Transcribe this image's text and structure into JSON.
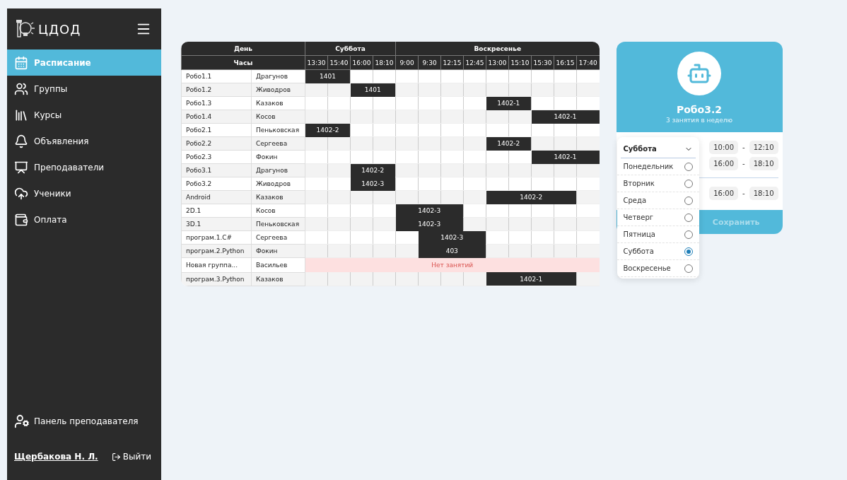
{
  "sidebar": {
    "logo_text": "ЦДОД",
    "items": [
      {
        "label": "Расписание",
        "selected": true
      },
      {
        "label": "Группы",
        "selected": false
      },
      {
        "label": "Курсы",
        "selected": false
      },
      {
        "label": "Объявления",
        "selected": false
      },
      {
        "label": "Преподаватели",
        "selected": false
      },
      {
        "label": "Ученики",
        "selected": false
      },
      {
        "label": "Оплата",
        "selected": false
      }
    ],
    "teacher_panel": "Панель преподавателя",
    "user_name": "Щербакова Н. Л.",
    "logout": "Выйти"
  },
  "schedule": {
    "day_header": "День",
    "hours_header": "Часы",
    "days": [
      {
        "name": "Суббота",
        "times": [
          "13:30",
          "15:40",
          "16:00",
          "18:10"
        ]
      },
      {
        "name": "Воскресенье",
        "times": [
          "9:00",
          "9:30",
          "12:15",
          "12:45",
          "13:00",
          "15:10",
          "15:30",
          "16:15",
          "17:40"
        ]
      }
    ],
    "rows": [
      {
        "group": "Робо1.1",
        "teacher": "Драгунов",
        "slots": [
          {
            "busy": true,
            "room": "1401"
          },
          {
            "busy": true
          },
          {
            "busy": false
          },
          {
            "busy": false
          },
          {
            "busy": false
          },
          {
            "busy": false
          },
          {
            "busy": false
          },
          {
            "busy": false
          },
          {
            "busy": false
          },
          {
            "busy": false
          },
          {
            "busy": false
          },
          {
            "busy": false
          },
          {
            "busy": false
          }
        ]
      },
      {
        "group": "Робо1.2",
        "teacher": "Живодров",
        "slots": [
          {
            "busy": false
          },
          {
            "busy": false
          },
          {
            "busy": true,
            "room": "1401"
          },
          {
            "busy": true
          },
          {
            "busy": false
          },
          {
            "busy": false
          },
          {
            "busy": false
          },
          {
            "busy": false
          },
          {
            "busy": false
          },
          {
            "busy": false
          },
          {
            "busy": false
          },
          {
            "busy": false
          },
          {
            "busy": false
          }
        ]
      },
      {
        "group": "Робо1.3",
        "teacher": "Казаков",
        "slots": [
          {
            "busy": false
          },
          {
            "busy": false
          },
          {
            "busy": false
          },
          {
            "busy": false
          },
          {
            "busy": false
          },
          {
            "busy": false
          },
          {
            "busy": false
          },
          {
            "busy": false
          },
          {
            "busy": true,
            "room": "1402-1"
          },
          {
            "busy": true
          },
          {
            "busy": false
          },
          {
            "busy": false
          },
          {
            "busy": false
          }
        ]
      },
      {
        "group": "Робо1.4",
        "teacher": "Косов",
        "slots": [
          {
            "busy": false
          },
          {
            "busy": false
          },
          {
            "busy": false
          },
          {
            "busy": false
          },
          {
            "busy": false
          },
          {
            "busy": false
          },
          {
            "busy": false
          },
          {
            "busy": false
          },
          {
            "busy": false
          },
          {
            "busy": false
          },
          {
            "busy": true,
            "room": "1402-1"
          },
          {
            "busy": true
          },
          {
            "busy": true
          }
        ]
      },
      {
        "group": "Робо2.1",
        "teacher": "Пеньковская",
        "slots": [
          {
            "busy": true,
            "room": "1402-2"
          },
          {
            "busy": true
          },
          {
            "busy": false
          },
          {
            "busy": false
          },
          {
            "busy": false
          },
          {
            "busy": false
          },
          {
            "busy": false
          },
          {
            "busy": false
          },
          {
            "busy": false
          },
          {
            "busy": false
          },
          {
            "busy": false
          },
          {
            "busy": false
          },
          {
            "busy": false
          }
        ]
      },
      {
        "group": "Робо2.2",
        "teacher": "Сергеева",
        "slots": [
          {
            "busy": false
          },
          {
            "busy": false
          },
          {
            "busy": false
          },
          {
            "busy": false
          },
          {
            "busy": false
          },
          {
            "busy": false
          },
          {
            "busy": false
          },
          {
            "busy": false
          },
          {
            "busy": true,
            "room": "1402-2"
          },
          {
            "busy": true
          },
          {
            "busy": false
          },
          {
            "busy": false
          },
          {
            "busy": false
          }
        ]
      },
      {
        "group": "Робо2.3",
        "teacher": "Фокин",
        "slots": [
          {
            "busy": false
          },
          {
            "busy": false
          },
          {
            "busy": false
          },
          {
            "busy": false
          },
          {
            "busy": false
          },
          {
            "busy": false
          },
          {
            "busy": false
          },
          {
            "busy": false
          },
          {
            "busy": false
          },
          {
            "busy": false
          },
          {
            "busy": true,
            "room": "1402-1"
          },
          {
            "busy": true
          },
          {
            "busy": true
          }
        ]
      },
      {
        "group": "Робо3.1",
        "teacher": "Драгунов",
        "slots": [
          {
            "busy": false
          },
          {
            "busy": false
          },
          {
            "busy": true,
            "room": "1402-2"
          },
          {
            "busy": true
          },
          {
            "busy": false
          },
          {
            "busy": false
          },
          {
            "busy": false
          },
          {
            "busy": false
          },
          {
            "busy": false
          },
          {
            "busy": false
          },
          {
            "busy": false
          },
          {
            "busy": false
          },
          {
            "busy": false
          }
        ]
      },
      {
        "group": "Робо3.2",
        "teacher": "Живодров",
        "slots": [
          {
            "busy": false
          },
          {
            "busy": false
          },
          {
            "busy": true,
            "room": "1402-3"
          },
          {
            "busy": true
          },
          {
            "busy": false
          },
          {
            "busy": false
          },
          {
            "busy": false
          },
          {
            "busy": false
          },
          {
            "busy": false
          },
          {
            "busy": false
          },
          {
            "busy": false
          },
          {
            "busy": false
          },
          {
            "busy": false
          }
        ]
      },
      {
        "group": "Android",
        "teacher": "Казаков",
        "slots": [
          {
            "busy": false
          },
          {
            "busy": false
          },
          {
            "busy": false
          },
          {
            "busy": false
          },
          {
            "busy": false
          },
          {
            "busy": false
          },
          {
            "busy": false
          },
          {
            "busy": false
          },
          {
            "busy": true,
            "room": "1402-2"
          },
          {
            "busy": true
          },
          {
            "busy": true
          },
          {
            "busy": true
          },
          {
            "busy": false
          }
        ]
      },
      {
        "group": "2D.1",
        "teacher": "Косов",
        "slots": [
          {
            "busy": false
          },
          {
            "busy": false
          },
          {
            "busy": false
          },
          {
            "busy": false
          },
          {
            "busy": true,
            "room": "1402-3"
          },
          {
            "busy": true
          },
          {
            "busy": true
          },
          {
            "busy": false
          },
          {
            "busy": false
          },
          {
            "busy": false
          },
          {
            "busy": false
          },
          {
            "busy": false
          },
          {
            "busy": false
          }
        ]
      },
      {
        "group": "3D.1",
        "teacher": "Пеньковская",
        "slots": [
          {
            "busy": false
          },
          {
            "busy": false
          },
          {
            "busy": false
          },
          {
            "busy": false
          },
          {
            "busy": true,
            "room": "1402-3"
          },
          {
            "busy": true
          },
          {
            "busy": true
          },
          {
            "busy": false
          },
          {
            "busy": false
          },
          {
            "busy": false
          },
          {
            "busy": false
          },
          {
            "busy": false
          },
          {
            "busy": false
          }
        ]
      },
      {
        "group": "програм.1.C#",
        "teacher": "Сергеева",
        "slots": [
          {
            "busy": false
          },
          {
            "busy": false
          },
          {
            "busy": false
          },
          {
            "busy": false
          },
          {
            "busy": false
          },
          {
            "busy": true,
            "room": "1402-3"
          },
          {
            "busy": true
          },
          {
            "busy": true
          },
          {
            "busy": false
          },
          {
            "busy": false
          },
          {
            "busy": false
          },
          {
            "busy": false
          },
          {
            "busy": false
          }
        ]
      },
      {
        "group": "програм.2.Python",
        "teacher": "Фокин",
        "slots": [
          {
            "busy": false
          },
          {
            "busy": false
          },
          {
            "busy": false
          },
          {
            "busy": false
          },
          {
            "busy": false
          },
          {
            "busy": true,
            "room": "403"
          },
          {
            "busy": true
          },
          {
            "busy": true
          },
          {
            "busy": false
          },
          {
            "busy": false
          },
          {
            "busy": false
          },
          {
            "busy": false
          },
          {
            "busy": false
          }
        ]
      },
      {
        "group": "Новая группа...",
        "teacher": "Васильев",
        "empty_note": "Нет занятий"
      },
      {
        "group": "програм.3.Python",
        "teacher": "Казаков",
        "slots": [
          {
            "busy": false
          },
          {
            "busy": false
          },
          {
            "busy": false
          },
          {
            "busy": false
          },
          {
            "busy": false
          },
          {
            "busy": false
          },
          {
            "busy": false
          },
          {
            "busy": false
          },
          {
            "busy": true,
            "room": "1402-1"
          },
          {
            "busy": true
          },
          {
            "busy": true
          },
          {
            "busy": true
          },
          {
            "busy": false
          }
        ]
      }
    ]
  },
  "group_card": {
    "title": "Робо3.2",
    "subtitle": "3 занятия в неделю",
    "times": [
      {
        "from": "10:00",
        "to": "12:10",
        "separator": "-",
        "divider_after": false
      },
      {
        "from": "16:00",
        "to": "18:10",
        "separator": "-",
        "divider_after": true
      },
      {
        "from": "16:00",
        "to": "18:10",
        "separator": "-",
        "divider_after": false
      }
    ],
    "save": "Сохранить",
    "day_dropdown": {
      "value": "Суббота",
      "options": [
        {
          "label": "Понедельник",
          "selected": false
        },
        {
          "label": "Вторник",
          "selected": false
        },
        {
          "label": "Среда",
          "selected": false
        },
        {
          "label": "Четверг",
          "selected": false
        },
        {
          "label": "Пятница",
          "selected": false
        },
        {
          "label": "Суббота",
          "selected": true
        },
        {
          "label": "Воскресенье",
          "selected": false
        }
      ]
    }
  }
}
